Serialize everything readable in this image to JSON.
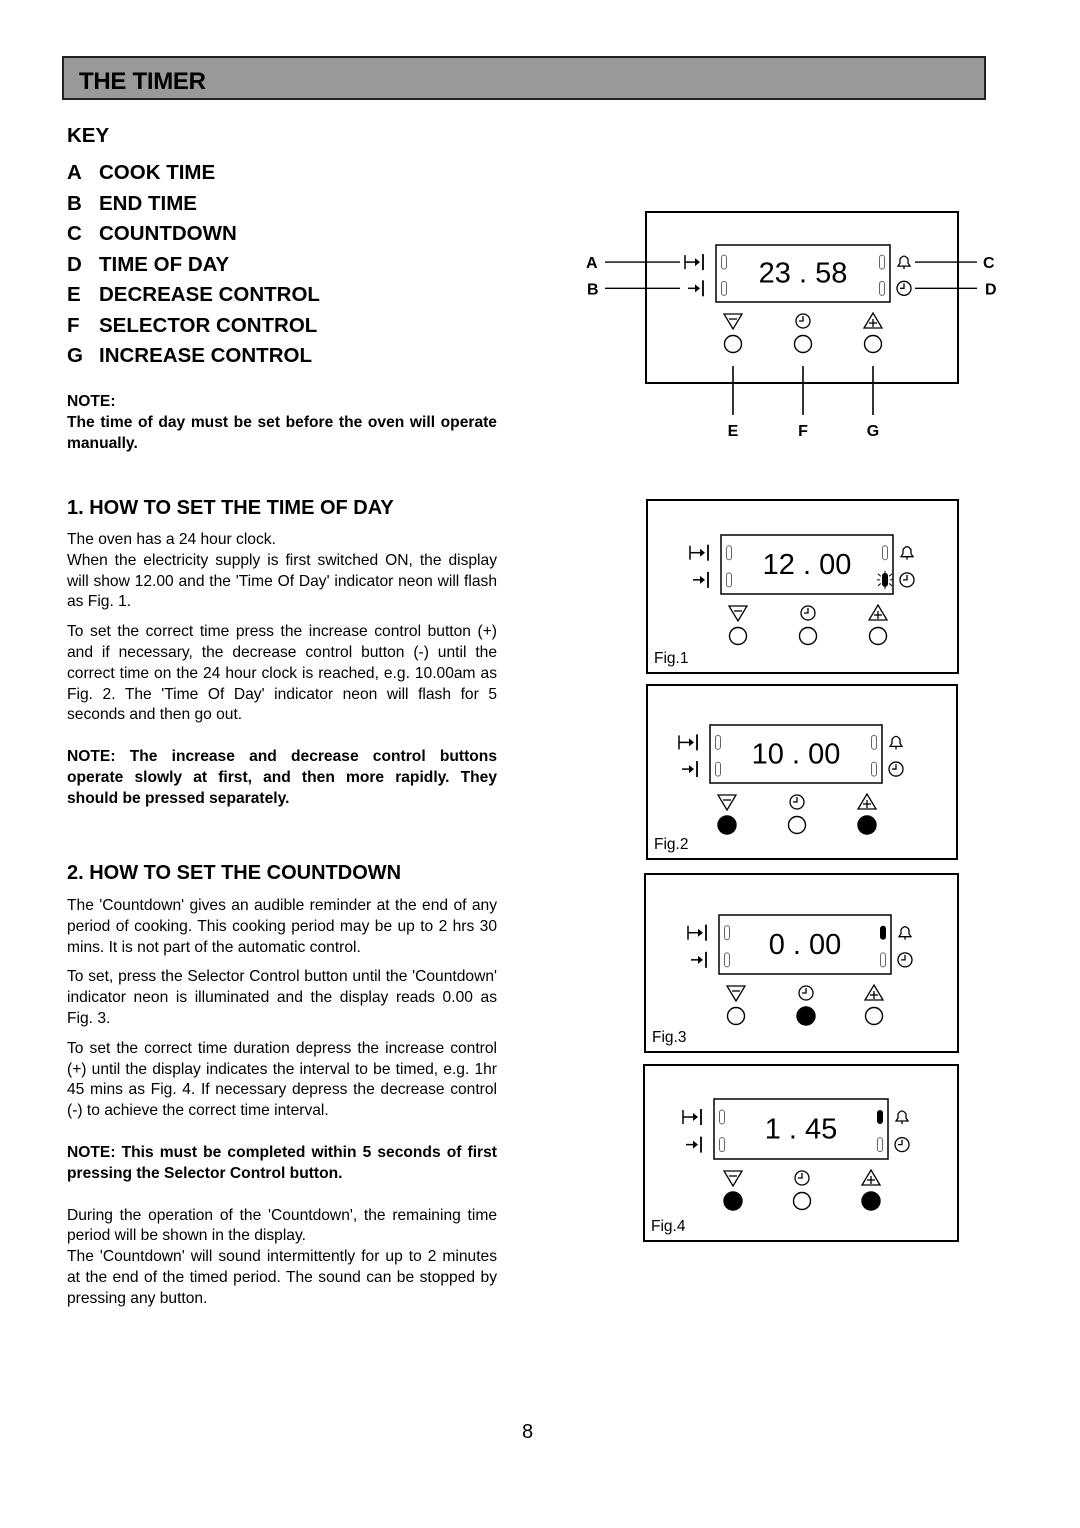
{
  "page": {
    "title": "THE TIMER",
    "page_number": "8"
  },
  "key": {
    "heading": "KEY",
    "items": [
      {
        "letter": "A",
        "label": "COOK TIME"
      },
      {
        "letter": "B",
        "label": "END TIME"
      },
      {
        "letter": "C",
        "label": "COUNTDOWN"
      },
      {
        "letter": "D",
        "label": "TIME OF DAY"
      },
      {
        "letter": "E",
        "label": "DECREASE CONTROL"
      },
      {
        "letter": "F",
        "label": "SELECTOR CONTROL"
      },
      {
        "letter": "G",
        "label": "INCREASE CONTROL"
      }
    ]
  },
  "note1": {
    "label": "NOTE:",
    "text": "The time of day must be set before the oven will operate manually."
  },
  "section1": {
    "heading": "1.  HOW TO SET THE TIME OF DAY",
    "p1a": "The oven has a 24 hour clock.",
    "p1b": "When the electricity supply is first switched ON, the display will show 12.00 and the 'Time Of Day' indicator neon will flash as Fig. 1.",
    "p2": "To set the correct time press the increase control button (+) and if necessary, the decrease control button (-) until the correct time on the 24 hour clock is reached, e.g. 10.00am as Fig. 2.  The 'Time Of Day' indicator neon will flash for 5 seconds and then go out.",
    "note": "NOTE:  The increase and decrease control buttons operate slowly at first, and then more rapidly.  They should be pressed separately."
  },
  "section2": {
    "heading": "2.  HOW TO SET THE COUNTDOWN",
    "p1": "The 'Countdown' gives an audible reminder at the end of any period of cooking.  This cooking period may be  up to 2 hrs 30 mins.  It is not part of the automatic control.",
    "p2": "To set, press the Selector Control button until the 'Countdown' indicator neon is illuminated and the display reads 0.00 as Fig. 3.",
    "p3": "To set the correct time duration depress the increase control (+) until the display indicates the interval to be timed, e.g. 1hr 45 mins as Fig. 4.  If necessary depress the decrease control (-) to achieve the correct time interval.",
    "note": "NOTE:  This must be completed within 5 seconds of first pressing the Selector Control button.",
    "p4a": "During the operation of the 'Countdown', the remaining time period will be shown in the display.",
    "p4b": "The 'Countdown' will sound intermittently for up to 2 minutes at the end of the timed period.  The sound can be stopped by pressing any button."
  },
  "diagrams": {
    "main": {
      "display": "23 . 58",
      "callouts": {
        "a": "A",
        "b": "B",
        "c": "C",
        "d": "D",
        "e": "E",
        "f": "F",
        "g": "G"
      },
      "neons": {
        "cook": "off",
        "end": "off",
        "countdown": "off",
        "timeofday": "off"
      },
      "buttons": {
        "decrease": "released",
        "selector": "released",
        "increase": "released"
      }
    },
    "figures": [
      {
        "caption": "Fig.1",
        "display": "12 . 00",
        "neons": {
          "cook": "off",
          "end": "off",
          "countdown": "off",
          "timeofday": "flashing"
        },
        "buttons": {
          "decrease": "released",
          "selector": "released",
          "increase": "released"
        }
      },
      {
        "caption": "Fig.2",
        "display": "10 . 00",
        "neons": {
          "cook": "off",
          "end": "off",
          "countdown": "off",
          "timeofday": "off"
        },
        "buttons": {
          "decrease": "pressed",
          "selector": "released",
          "increase": "pressed"
        }
      },
      {
        "caption": "Fig.3",
        "display": "0 . 00",
        "neons": {
          "cook": "off",
          "end": "off",
          "countdown": "on",
          "timeofday": "off"
        },
        "buttons": {
          "decrease": "released",
          "selector": "pressed",
          "increase": "released"
        }
      },
      {
        "caption": "Fig.4",
        "display": "1 . 45",
        "neons": {
          "cook": "off",
          "end": "off",
          "countdown": "on",
          "timeofday": "off"
        },
        "buttons": {
          "decrease": "pressed",
          "selector": "released",
          "increase": "pressed"
        }
      }
    ]
  }
}
